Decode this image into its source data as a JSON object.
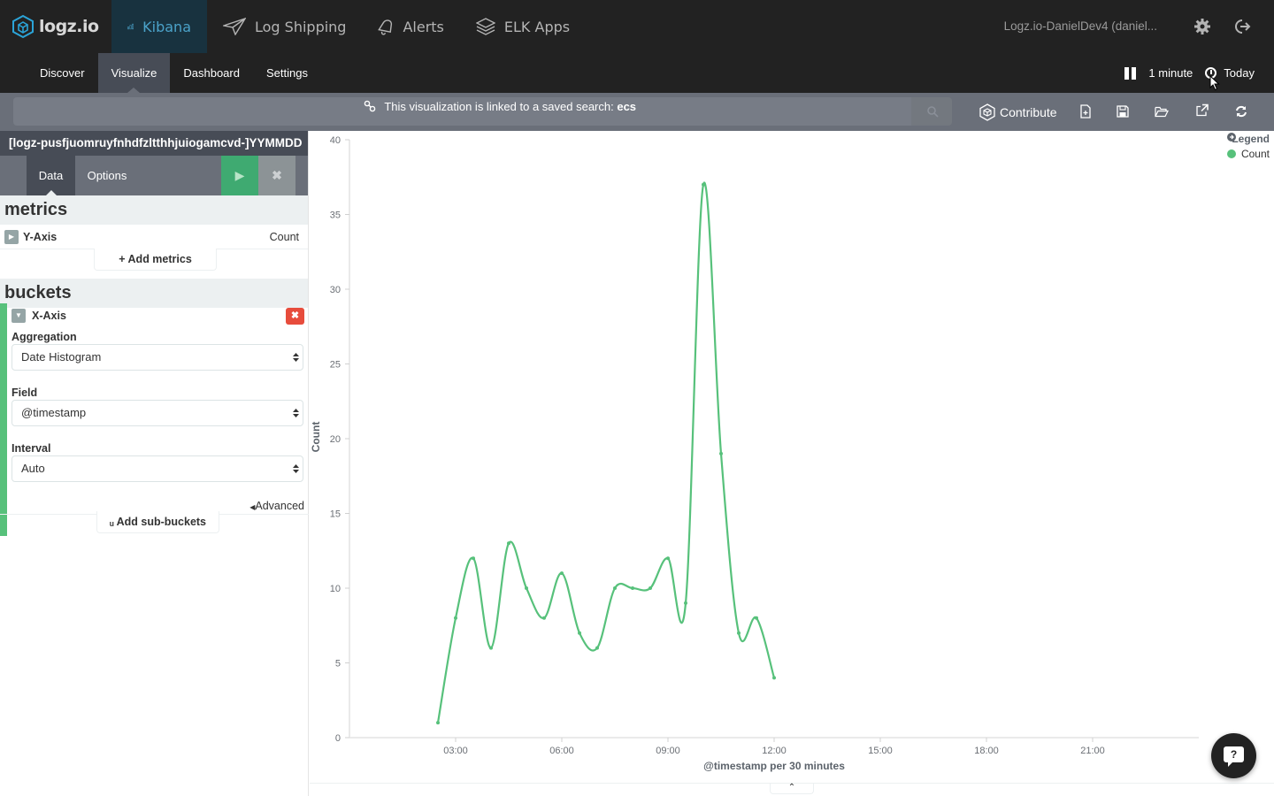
{
  "app": {
    "logo_text": "logz.io",
    "account": "Logz.io-DanielDev4 (daniel...",
    "top_nav": [
      {
        "label": "Kibana",
        "icon": "bar-chart-icon",
        "active": true
      },
      {
        "label": "Log Shipping",
        "icon": "paper-plane-icon",
        "active": false
      },
      {
        "label": "Alerts",
        "icon": "bell-icon",
        "active": false
      },
      {
        "label": "ELK Apps",
        "icon": "layers-icon",
        "active": false
      }
    ],
    "sub_nav": [
      {
        "label": "Discover",
        "active": false
      },
      {
        "label": "Visualize",
        "active": true
      },
      {
        "label": "Dashboard",
        "active": false
      },
      {
        "label": "Settings",
        "active": false
      }
    ],
    "refresh_interval": "1 minute",
    "time_range": "Today"
  },
  "query_bar": {
    "message": "This visualization is linked to a saved search: ",
    "saved_search": "ecs",
    "contribute_label": "Contribute",
    "tools": [
      "new-visualization-icon",
      "save-icon",
      "open-icon",
      "share-icon",
      "refresh-icon"
    ]
  },
  "sidebar": {
    "index_pattern": "[logz-pusfjuomruyfnhdfzltthhjuiogamcvd-]YYMMDD",
    "tabs": [
      "Data",
      "Options"
    ],
    "metrics": {
      "heading": "metrics",
      "items": [
        {
          "title": "Y-Axis",
          "description": "Count"
        }
      ],
      "add_label": "Add metrics"
    },
    "buckets": {
      "heading": "buckets",
      "title": "X-Axis",
      "aggregation_label": "Aggregation",
      "aggregation_value": "Date Histogram",
      "field_label": "Field",
      "field_value": "@timestamp",
      "interval_label": "Interval",
      "interval_value": "Auto",
      "advanced_label": "Advanced",
      "add_label": "Add sub-buckets"
    }
  },
  "chart_data": {
    "type": "line",
    "title": "",
    "xlabel": "@timestamp per 30 minutes",
    "ylabel": "Count",
    "ylim": [
      0,
      40
    ],
    "yticks": [
      0,
      5,
      10,
      15,
      20,
      25,
      30,
      35,
      40
    ],
    "xlim_hours": [
      0,
      24
    ],
    "xticks": [
      {
        "label": "03:00",
        "hour": 3
      },
      {
        "label": "06:00",
        "hour": 6
      },
      {
        "label": "09:00",
        "hour": 9
      },
      {
        "label": "12:00",
        "hour": 12
      },
      {
        "label": "15:00",
        "hour": 15
      },
      {
        "label": "18:00",
        "hour": 18
      },
      {
        "label": "21:00",
        "hour": 21
      }
    ],
    "legend": {
      "title": "Legend",
      "position": "top-right"
    },
    "series": [
      {
        "name": "Count",
        "color": "#57c17b",
        "x": [
          "02:30",
          "03:00",
          "03:30",
          "04:00",
          "04:30",
          "05:00",
          "05:30",
          "06:00",
          "06:30",
          "07:00",
          "07:30",
          "08:00",
          "08:30",
          "09:00",
          "09:30",
          "10:00",
          "10:30",
          "11:00",
          "11:30",
          "12:00"
        ],
        "values": [
          1,
          8,
          12,
          6,
          13,
          10,
          8,
          11,
          7,
          6,
          10,
          10,
          10,
          12,
          9,
          37,
          19,
          7,
          8,
          4
        ]
      }
    ],
    "grid": false
  }
}
